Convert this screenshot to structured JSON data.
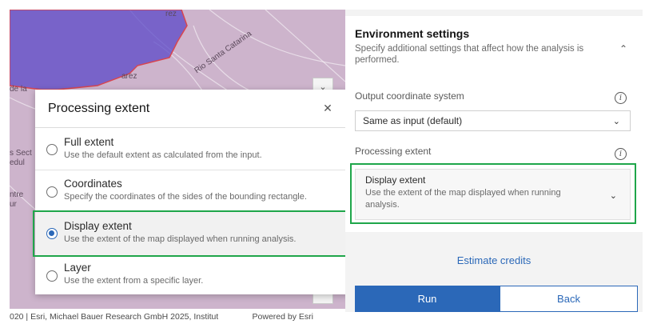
{
  "map": {
    "labels": [
      "rez",
      "Rio Santa Catarina",
      "arez",
      "de la",
      "s Sect",
      "edul",
      "ntre",
      "ur"
    ],
    "attribution_left": "020 | Esri, Michael Bauer Research GmbH 2025, Institut",
    "attribution_right": "Powered by Esri",
    "zoom_label": "⌄"
  },
  "popup": {
    "title": "Processing extent",
    "close": "✕",
    "options": [
      {
        "title": "Full extent",
        "desc": "Use the default extent as calculated from the input."
      },
      {
        "title": "Coordinates",
        "desc": "Specify the coordinates of the sides of the bounding rectangle."
      },
      {
        "title": "Display extent",
        "desc": "Use the extent of the map displayed when running analysis."
      },
      {
        "title": "Layer",
        "desc": "Use the extent from a specific layer."
      }
    ],
    "selected_index": 2
  },
  "panel": {
    "env_title": "Environment settings",
    "env_desc": "Specify additional settings that affect how the analysis is performed.",
    "output_label": "Output coordinate system",
    "output_value": "Same as input (default)",
    "extent_label": "Processing extent",
    "extent_title": "Display extent",
    "extent_desc": "Use the extent of the map displayed when running analysis.",
    "estimate": "Estimate credits",
    "run": "Run",
    "back": "Back"
  },
  "icons": {
    "info": "i",
    "chevron_down": "⌄",
    "chevron_up": "⌃"
  },
  "colors": {
    "accent": "#2b68b8",
    "highlight": "#1fa64a",
    "map_fill": "#cdb4cc",
    "map_overlay": "#5b48c8",
    "map_edge": "#d8454f"
  }
}
